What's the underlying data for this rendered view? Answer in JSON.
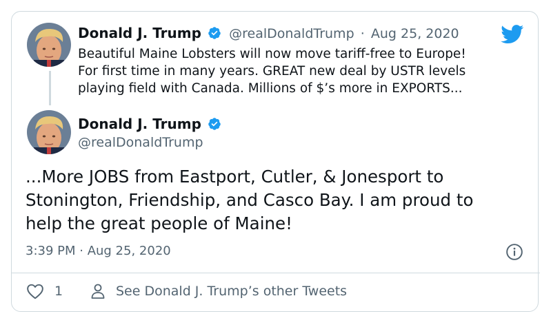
{
  "quoted_tweet": {
    "author_name": "Donald J. Trump",
    "author_handle": "@realDonaldTrump",
    "separator": "·",
    "date": "Aug 25, 2020",
    "lines": [
      "Beautiful Maine Lobsters will now move tariff-free to Europe!",
      "For first time in many years. GREAT new deal by USTR levels",
      "playing field with Canada. Millions of $’s more in EXPORTS..."
    ]
  },
  "main_tweet": {
    "author_name": "Donald J. Trump",
    "author_handle": "@realDonaldTrump",
    "lines": [
      "...More JOBS from Eastport, Cutler, & Jonesport to",
      "Stonington, Friendship, and Casco Bay. I am proud to",
      "help the great people of Maine!"
    ],
    "timestamp": "3:39 PM · Aug 25, 2020"
  },
  "footer": {
    "like_count": "1",
    "profile_link_label": "See Donald J. Trump’s other Tweets"
  },
  "icons": {
    "brand": "twitter-bird-icon",
    "verified": "verified-badge-icon",
    "info": "info-icon",
    "like": "heart-icon",
    "person": "person-icon"
  },
  "colors": {
    "twitter_blue": "#1d9bf0",
    "text_primary": "#0f1419",
    "text_secondary": "#536471",
    "border": "#cfd9de"
  }
}
